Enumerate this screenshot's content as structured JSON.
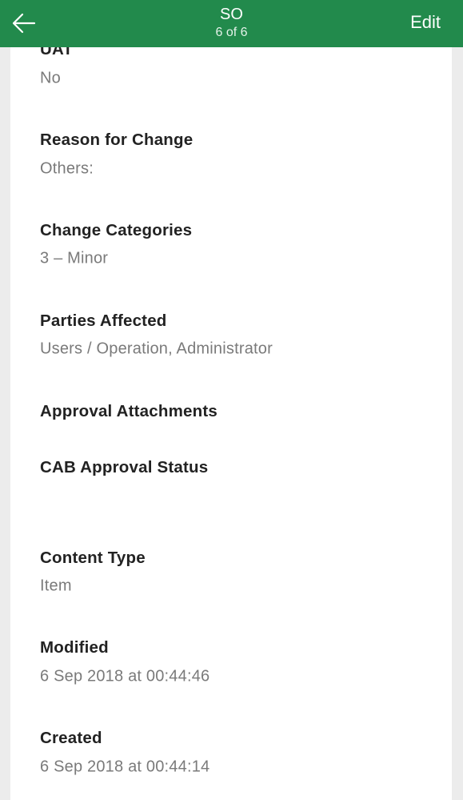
{
  "header": {
    "title": "SO",
    "subtitle": "6 of 6",
    "edit_label": "Edit",
    "back_icon": "arrow-left-icon",
    "color": "#228a4c"
  },
  "fields": [
    {
      "label": "UAT",
      "value": "No"
    },
    {
      "label": "Reason for Change",
      "value": "Others:"
    },
    {
      "label": "Change Categories",
      "value": "3 – Minor"
    },
    {
      "label": "Parties Affected",
      "value": "Users / Operation, Administrator"
    },
    {
      "label": "Approval Attachments",
      "value": ""
    },
    {
      "label": "CAB Approval Status",
      "value": ""
    },
    {
      "label": "Content Type",
      "value": "Item"
    },
    {
      "label": "Modified",
      "value": "6 Sep 2018 at 00:44:46"
    },
    {
      "label": "Created",
      "value": "6 Sep 2018 at 00:44:14"
    }
  ]
}
